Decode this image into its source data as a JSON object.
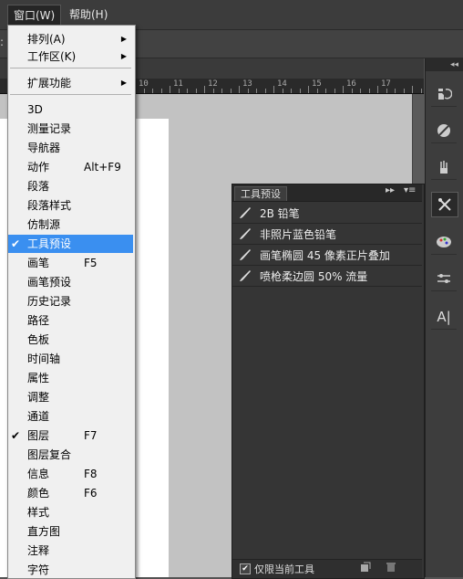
{
  "menubar": {
    "window_label": "窗口(W)",
    "help_label": "帮助(H)"
  },
  "optbar": {
    "colon": ":"
  },
  "ruler": {
    "labels": [
      "10",
      "11",
      "12",
      "13",
      "14",
      "15",
      "16",
      "17"
    ]
  },
  "dropdown": {
    "items": [
      {
        "label": "排列(A)",
        "submenu": true
      },
      {
        "label": "工作区(K)",
        "submenu": true
      },
      {
        "label": "扩展功能",
        "submenu": true
      },
      {
        "label": "3D"
      },
      {
        "label": "测量记录"
      },
      {
        "label": "导航器"
      },
      {
        "label": "动作",
        "shortcut": "Alt+F9"
      },
      {
        "label": "段落"
      },
      {
        "label": "段落样式"
      },
      {
        "label": "仿制源"
      },
      {
        "label": "工具预设",
        "checked": true,
        "highlighted": true
      },
      {
        "label": "画笔",
        "shortcut": "F5"
      },
      {
        "label": "画笔预设"
      },
      {
        "label": "历史记录"
      },
      {
        "label": "路径"
      },
      {
        "label": "色板"
      },
      {
        "label": "时间轴"
      },
      {
        "label": "属性"
      },
      {
        "label": "调整"
      },
      {
        "label": "通道"
      },
      {
        "label": "图层",
        "shortcut": "F7",
        "checked": true
      },
      {
        "label": "图层复合"
      },
      {
        "label": "信息",
        "shortcut": "F8"
      },
      {
        "label": "颜色",
        "shortcut": "F6"
      },
      {
        "label": "样式"
      },
      {
        "label": "直方图"
      },
      {
        "label": "注释"
      },
      {
        "label": "字符"
      }
    ],
    "submenu_arrow": "▶",
    "check_mark": "✔"
  },
  "panel": {
    "tab_label": "工具预设",
    "collapse_glyph": "▸▸",
    "menu_glyph": "▾≡",
    "presets": [
      "2B 铅笔",
      "非照片蓝色铅笔",
      "画笔椭圆 45 像素正片叠加",
      "喷枪柔边圆 50% 流量"
    ],
    "footer_label": "仅限当前工具",
    "footer_checked": "✔"
  },
  "dock": {
    "collapse_glyph": "◂◂",
    "text_tool_glyph": "A|"
  },
  "colors": {
    "menu_highlight": "#3a8ff0",
    "panel_bg": "#353535",
    "canvas_bg": "#c2c2c2"
  }
}
